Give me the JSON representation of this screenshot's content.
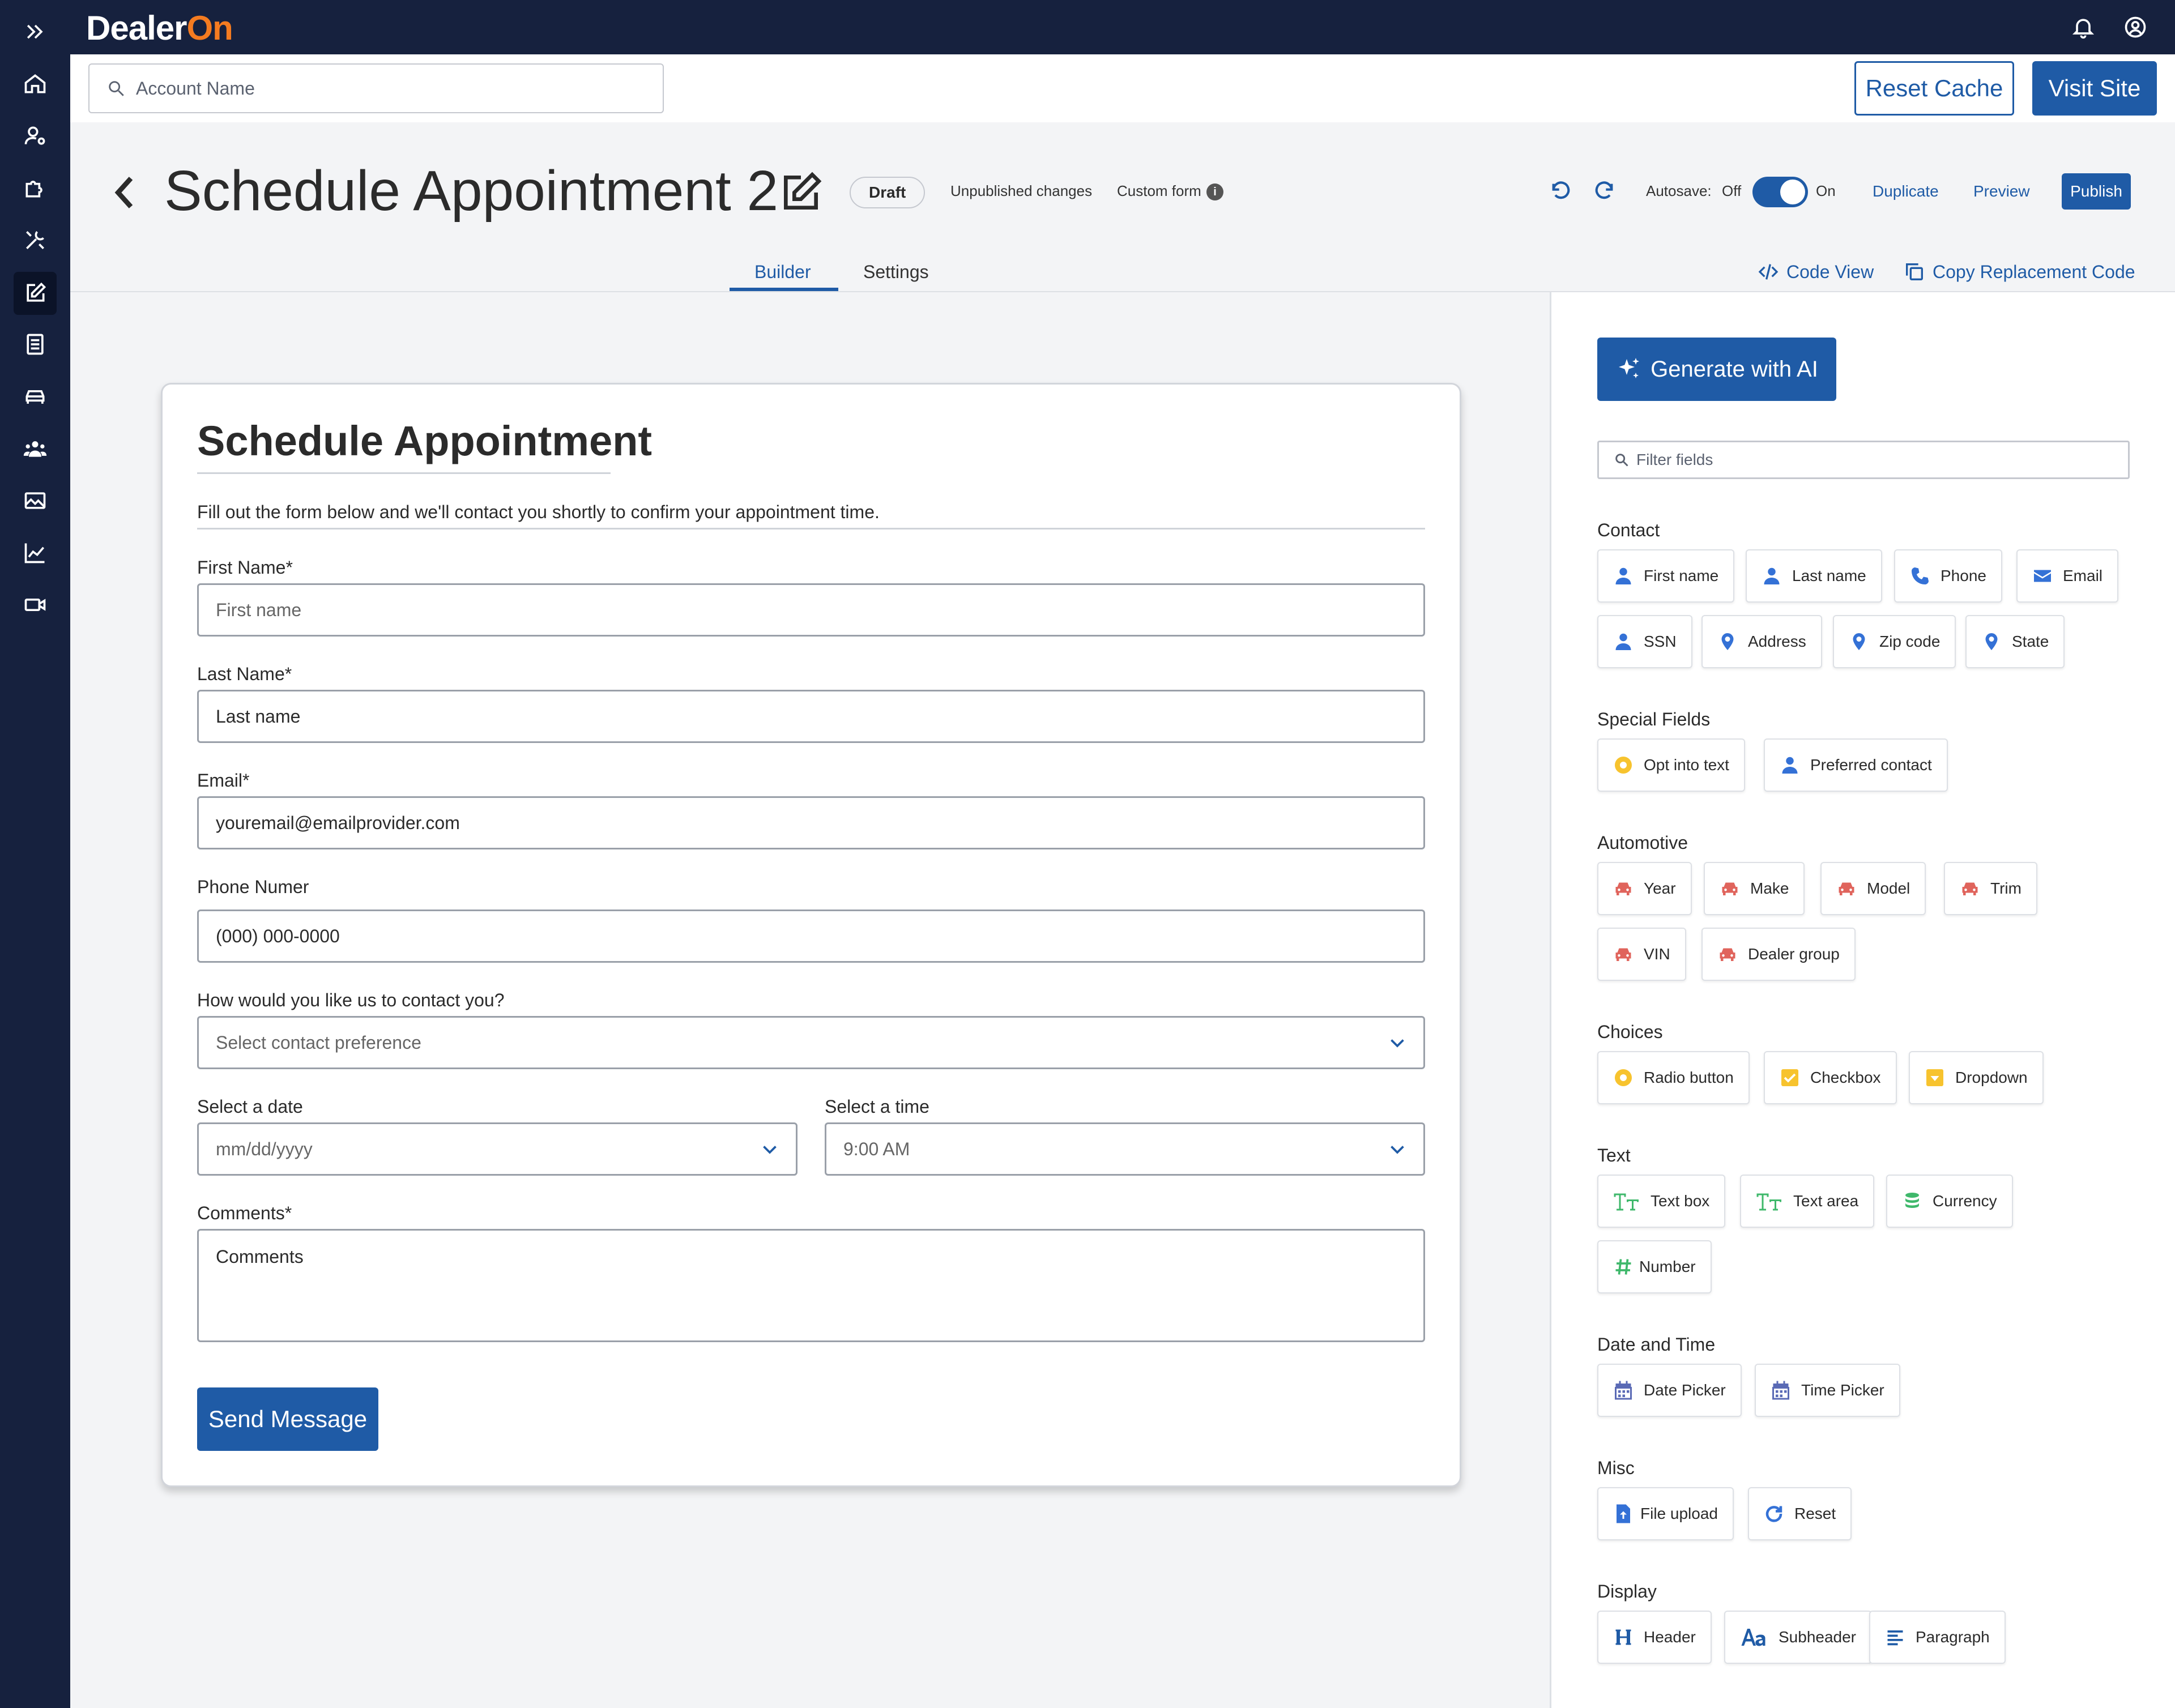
{
  "app": {
    "logo_main": "Dealer",
    "logo_accent": "On"
  },
  "header": {
    "search_placeholder": "Account Name",
    "reset_cache": "Reset Cache",
    "visit_site": "Visit Site"
  },
  "page": {
    "title": "Schedule Appointment 2",
    "status_badge": "Draft",
    "unpublished": "Unpublished changes",
    "custom_form": "Custom form",
    "autosave_label": "Autosave:",
    "autosave_off": "Off",
    "autosave_on": "On",
    "autosave_enabled": true,
    "duplicate": "Duplicate",
    "preview": "Preview",
    "publish": "Publish"
  },
  "tabs": [
    {
      "label": "Builder",
      "active": true
    },
    {
      "label": "Settings",
      "active": false
    }
  ],
  "code_view": "Code View",
  "copy_replacement": "Copy Replacement Code",
  "form": {
    "title": "Schedule Appointment",
    "description": "Fill out the form below and we'll contact you shortly to confirm your appointment time.",
    "first_name": {
      "label": "First Name*",
      "placeholder": "First name"
    },
    "last_name": {
      "label": "Last Name*",
      "value": "Last name"
    },
    "email": {
      "label": "Email*",
      "value": "youremail@emailprovider.com"
    },
    "phone": {
      "label": "Phone Numer",
      "value": "(000) 000-0000"
    },
    "contact_pref": {
      "label": "How would you like us to contact you?",
      "placeholder": "Select contact preference"
    },
    "date": {
      "label": "Select a date",
      "placeholder": "mm/dd/yyyy"
    },
    "time": {
      "label": "Select a time",
      "value": "9:00 AM"
    },
    "comments": {
      "label": "Comments*",
      "value": "Comments"
    },
    "submit": "Send Message"
  },
  "panel": {
    "generate_ai": "Generate with AI",
    "filter_placeholder": "Filter fields",
    "sections": [
      {
        "title": "Contact",
        "items": [
          {
            "label": "First name",
            "icon": "person-icon"
          },
          {
            "label": "Last name",
            "icon": "person-icon"
          },
          {
            "label": "Phone",
            "icon": "phone-icon"
          },
          {
            "label": "Email",
            "icon": "envelope-icon"
          },
          {
            "label": "SSN",
            "icon": "person-icon"
          },
          {
            "label": "Address",
            "icon": "location-pin-icon"
          },
          {
            "label": "Zip code",
            "icon": "location-pin-icon"
          },
          {
            "label": "State",
            "icon": "location-pin-icon"
          }
        ]
      },
      {
        "title": "Special Fields",
        "items": [
          {
            "label": "Opt into text",
            "icon": "radio-icon"
          },
          {
            "label": "Preferred contact",
            "icon": "person-icon"
          }
        ]
      },
      {
        "title": "Automotive",
        "items": [
          {
            "label": "Year",
            "icon": "car-icon"
          },
          {
            "label": "Make",
            "icon": "car-icon"
          },
          {
            "label": "Model",
            "icon": "car-icon"
          },
          {
            "label": "Trim",
            "icon": "car-icon"
          },
          {
            "label": "VIN",
            "icon": "car-icon"
          },
          {
            "label": "Dealer group",
            "icon": "car-icon"
          }
        ]
      },
      {
        "title": "Choices",
        "items": [
          {
            "label": "Radio button",
            "icon": "radio-icon"
          },
          {
            "label": "Checkbox",
            "icon": "checkbox-icon"
          },
          {
            "label": "Dropdown",
            "icon": "dropdown-icon"
          }
        ]
      },
      {
        "title": "Text",
        "items": [
          {
            "label": "Text box",
            "icon": "text-icon"
          },
          {
            "label": "Text area",
            "icon": "text-icon"
          },
          {
            "label": "Currency",
            "icon": "coins-icon"
          },
          {
            "label": "Number",
            "icon": "hash-icon"
          }
        ]
      },
      {
        "title": "Date and Time",
        "items": [
          {
            "label": "Date Picker",
            "icon": "calendar-icon"
          },
          {
            "label": "Time Picker",
            "icon": "calendar-icon"
          }
        ]
      },
      {
        "title": "Misc",
        "items": [
          {
            "label": "File upload",
            "icon": "file-upload-icon"
          },
          {
            "label": "Reset",
            "icon": "reset-icon"
          }
        ]
      },
      {
        "title": "Display",
        "items": [
          {
            "label": "Header",
            "icon": "header-icon"
          },
          {
            "label": "Subheader",
            "icon": "subheader-icon"
          },
          {
            "label": "Paragraph",
            "icon": "paragraph-icon"
          }
        ]
      }
    ]
  },
  "colors": {
    "navy": "#16213e",
    "primary": "#1f5ba6",
    "orange": "#f47b20",
    "car_red": "#e0645c",
    "green": "#3fb86b",
    "yellow": "#f7c32e"
  }
}
